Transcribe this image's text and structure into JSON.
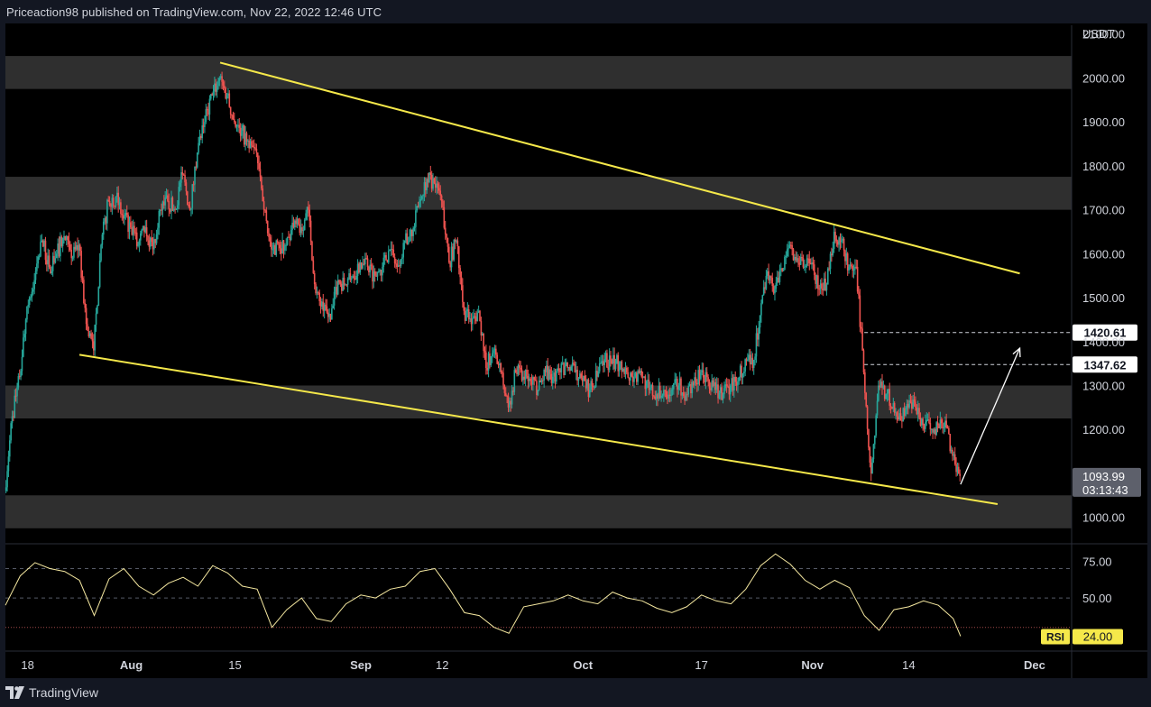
{
  "header": {
    "publisher": "Priceaction98 published on TradingView.com, Nov 22, 2022 12:46 UTC"
  },
  "footer": {
    "brand": "TradingView"
  },
  "colors": {
    "bull": "#26a69a",
    "bear": "#ef5350",
    "trendline": "#f5e84a",
    "zone": "#2f2f2f",
    "rsi": "#f5e8a0",
    "arrow": "#ffffff"
  },
  "chart_data": {
    "type": "candlestick",
    "currency_label": "USDT",
    "price_axis": {
      "ylim": [
        950,
        2120
      ],
      "ticks": [
        {
          "v": 2100,
          "label": "2100.00"
        },
        {
          "v": 2000,
          "label": "2000.00"
        },
        {
          "v": 1900,
          "label": "1900.00"
        },
        {
          "v": 1800,
          "label": "1800.00"
        },
        {
          "v": 1700,
          "label": "1700.00"
        },
        {
          "v": 1600,
          "label": "1600.00"
        },
        {
          "v": 1500,
          "label": "1500.00"
        },
        {
          "v": 1400,
          "label": "1400.00"
        },
        {
          "v": 1300,
          "label": "1300.00"
        },
        {
          "v": 1200,
          "label": "1200.00"
        },
        {
          "v": 1000,
          "label": "1000.00"
        }
      ]
    },
    "time_axis": {
      "xlim": [
        "2022-07-15",
        "2022-12-06"
      ],
      "ticks": [
        {
          "date": "2022-07-18",
          "label": "18",
          "bold": false
        },
        {
          "date": "2022-08-01",
          "label": "Aug",
          "bold": true
        },
        {
          "date": "2022-08-15",
          "label": "15",
          "bold": false
        },
        {
          "date": "2022-09-01",
          "label": "Sep",
          "bold": true
        },
        {
          "date": "2022-09-12",
          "label": "12",
          "bold": false
        },
        {
          "date": "2022-10-01",
          "label": "Oct",
          "bold": true
        },
        {
          "date": "2022-10-17",
          "label": "17",
          "bold": false
        },
        {
          "date": "2022-11-01",
          "label": "Nov",
          "bold": true
        },
        {
          "date": "2022-11-14",
          "label": "14",
          "bold": false
        },
        {
          "date": "2022-12-01",
          "label": "Dec",
          "bold": true
        }
      ]
    },
    "zones": [
      {
        "low": 1975,
        "high": 2050
      },
      {
        "low": 1700,
        "high": 1775
      },
      {
        "low": 1225,
        "high": 1300
      },
      {
        "low": 975,
        "high": 1050
      }
    ],
    "trendlines": [
      {
        "from": [
          "2022-08-13",
          2035
        ],
        "to": [
          "2022-11-29",
          1555
        ]
      },
      {
        "from": [
          "2022-07-25",
          1370
        ],
        "to": [
          "2022-11-26",
          1030
        ]
      }
    ],
    "hlines": [
      {
        "value": 1420.61,
        "from": "2022-11-08",
        "label": "1420.61"
      },
      {
        "value": 1347.62,
        "from": "2022-11-08",
        "label": "1347.62"
      }
    ],
    "projection_arrow": {
      "from": [
        "2022-11-21",
        1075
      ],
      "to": [
        "2022-11-29",
        1385
      ]
    },
    "last_price": {
      "value": 1093.99,
      "label": "1093.99",
      "countdown": "03:13:43"
    },
    "price_path": [
      [
        "2022-07-15",
        1060
      ],
      [
        "2022-07-16",
        1230
      ],
      [
        "2022-07-17",
        1320
      ],
      [
        "2022-07-18",
        1480
      ],
      [
        "2022-07-19",
        1540
      ],
      [
        "2022-07-20",
        1630
      ],
      [
        "2022-07-21",
        1570
      ],
      [
        "2022-07-22",
        1600
      ],
      [
        "2022-07-23",
        1640
      ],
      [
        "2022-07-24",
        1590
      ],
      [
        "2022-07-25",
        1620
      ],
      [
        "2022-07-26",
        1440
      ],
      [
        "2022-07-27",
        1380
      ],
      [
        "2022-07-28",
        1620
      ],
      [
        "2022-07-29",
        1720
      ],
      [
        "2022-07-30",
        1730
      ],
      [
        "2022-07-31",
        1680
      ],
      [
        "2022-08-01",
        1660
      ],
      [
        "2022-08-02",
        1620
      ],
      [
        "2022-08-03",
        1660
      ],
      [
        "2022-08-04",
        1610
      ],
      [
        "2022-08-05",
        1700
      ],
      [
        "2022-08-06",
        1720
      ],
      [
        "2022-08-07",
        1700
      ],
      [
        "2022-08-08",
        1780
      ],
      [
        "2022-08-09",
        1700
      ],
      [
        "2022-08-10",
        1830
      ],
      [
        "2022-08-11",
        1900
      ],
      [
        "2022-08-12",
        1960
      ],
      [
        "2022-08-13",
        2000
      ],
      [
        "2022-08-14",
        1960
      ],
      [
        "2022-08-15",
        1900
      ],
      [
        "2022-08-16",
        1880
      ],
      [
        "2022-08-17",
        1840
      ],
      [
        "2022-08-18",
        1830
      ],
      [
        "2022-08-19",
        1700
      ],
      [
        "2022-08-20",
        1610
      ],
      [
        "2022-08-21",
        1620
      ],
      [
        "2022-08-22",
        1620
      ],
      [
        "2022-08-23",
        1660
      ],
      [
        "2022-08-24",
        1660
      ],
      [
        "2022-08-25",
        1700
      ],
      [
        "2022-08-26",
        1510
      ],
      [
        "2022-08-27",
        1470
      ],
      [
        "2022-08-28",
        1450
      ],
      [
        "2022-08-29",
        1540
      ],
      [
        "2022-08-30",
        1530
      ],
      [
        "2022-08-31",
        1550
      ],
      [
        "2022-09-01",
        1580
      ],
      [
        "2022-09-02",
        1570
      ],
      [
        "2022-09-03",
        1550
      ],
      [
        "2022-09-04",
        1570
      ],
      [
        "2022-09-05",
        1610
      ],
      [
        "2022-09-06",
        1570
      ],
      [
        "2022-09-07",
        1630
      ],
      [
        "2022-09-08",
        1640
      ],
      [
        "2022-09-09",
        1720
      ],
      [
        "2022-09-10",
        1770
      ],
      [
        "2022-09-11",
        1760
      ],
      [
        "2022-09-12",
        1720
      ],
      [
        "2022-09-13",
        1580
      ],
      [
        "2022-09-14",
        1630
      ],
      [
        "2022-09-15",
        1470
      ],
      [
        "2022-09-16",
        1440
      ],
      [
        "2022-09-17",
        1470
      ],
      [
        "2022-09-18",
        1340
      ],
      [
        "2022-09-19",
        1380
      ],
      [
        "2022-09-20",
        1330
      ],
      [
        "2022-09-21",
        1250
      ],
      [
        "2022-09-22",
        1330
      ],
      [
        "2022-09-23",
        1320
      ],
      [
        "2022-09-24",
        1310
      ],
      [
        "2022-09-25",
        1290
      ],
      [
        "2022-09-26",
        1330
      ],
      [
        "2022-09-27",
        1320
      ],
      [
        "2022-09-28",
        1330
      ],
      [
        "2022-09-29",
        1340
      ],
      [
        "2022-09-30",
        1330
      ],
      [
        "2022-10-01",
        1310
      ],
      [
        "2022-10-02",
        1290
      ],
      [
        "2022-10-03",
        1320
      ],
      [
        "2022-10-04",
        1360
      ],
      [
        "2022-10-05",
        1350
      ],
      [
        "2022-10-06",
        1350
      ],
      [
        "2022-10-07",
        1330
      ],
      [
        "2022-10-08",
        1320
      ],
      [
        "2022-10-09",
        1320
      ],
      [
        "2022-10-10",
        1290
      ],
      [
        "2022-10-11",
        1280
      ],
      [
        "2022-10-12",
        1290
      ],
      [
        "2022-10-13",
        1290
      ],
      [
        "2022-10-14",
        1300
      ],
      [
        "2022-10-15",
        1280
      ],
      [
        "2022-10-16",
        1300
      ],
      [
        "2022-10-17",
        1330
      ],
      [
        "2022-10-18",
        1310
      ],
      [
        "2022-10-19",
        1290
      ],
      [
        "2022-10-20",
        1280
      ],
      [
        "2022-10-21",
        1300
      ],
      [
        "2022-10-22",
        1310
      ],
      [
        "2022-10-23",
        1360
      ],
      [
        "2022-10-24",
        1340
      ],
      [
        "2022-10-25",
        1460
      ],
      [
        "2022-10-26",
        1560
      ],
      [
        "2022-10-27",
        1520
      ],
      [
        "2022-10-28",
        1560
      ],
      [
        "2022-10-29",
        1620
      ],
      [
        "2022-10-30",
        1590
      ],
      [
        "2022-10-31",
        1570
      ],
      [
        "2022-11-01",
        1580
      ],
      [
        "2022-11-02",
        1520
      ],
      [
        "2022-11-03",
        1530
      ],
      [
        "2022-11-04",
        1650
      ],
      [
        "2022-11-05",
        1630
      ],
      [
        "2022-11-06",
        1570
      ],
      [
        "2022-11-07",
        1570
      ],
      [
        "2022-11-08",
        1330
      ],
      [
        "2022-11-09",
        1100
      ],
      [
        "2022-11-10",
        1300
      ],
      [
        "2022-11-11",
        1280
      ],
      [
        "2022-11-12",
        1260
      ],
      [
        "2022-11-13",
        1220
      ],
      [
        "2022-11-14",
        1250
      ],
      [
        "2022-11-15",
        1250
      ],
      [
        "2022-11-16",
        1210
      ],
      [
        "2022-11-17",
        1200
      ],
      [
        "2022-11-18",
        1210
      ],
      [
        "2022-11-19",
        1220
      ],
      [
        "2022-11-20",
        1140
      ],
      [
        "2022-11-21",
        1094
      ]
    ],
    "rsi": {
      "label": "RSI",
      "value_label": "24.00",
      "ylim": [
        20,
        85
      ],
      "levels": [
        {
          "v": 70,
          "style": "dashed"
        },
        {
          "v": 50,
          "style": "dashed"
        },
        {
          "v": 30,
          "style": "dotted"
        }
      ],
      "ticks": [
        {
          "v": 75,
          "label": "75.00"
        },
        {
          "v": 50,
          "label": "50.00"
        }
      ],
      "path": [
        [
          "2022-07-15",
          45
        ],
        [
          "2022-07-17",
          65
        ],
        [
          "2022-07-19",
          74
        ],
        [
          "2022-07-21",
          70
        ],
        [
          "2022-07-23",
          68
        ],
        [
          "2022-07-25",
          62
        ],
        [
          "2022-07-27",
          38
        ],
        [
          "2022-07-29",
          63
        ],
        [
          "2022-07-31",
          70
        ],
        [
          "2022-08-02",
          58
        ],
        [
          "2022-08-04",
          52
        ],
        [
          "2022-08-06",
          60
        ],
        [
          "2022-08-08",
          64
        ],
        [
          "2022-08-10",
          58
        ],
        [
          "2022-08-12",
          72
        ],
        [
          "2022-08-14",
          67
        ],
        [
          "2022-08-16",
          58
        ],
        [
          "2022-08-18",
          56
        ],
        [
          "2022-08-20",
          30
        ],
        [
          "2022-08-22",
          42
        ],
        [
          "2022-08-24",
          50
        ],
        [
          "2022-08-26",
          36
        ],
        [
          "2022-08-28",
          34
        ],
        [
          "2022-08-30",
          46
        ],
        [
          "2022-09-01",
          52
        ],
        [
          "2022-09-03",
          50
        ],
        [
          "2022-09-05",
          56
        ],
        [
          "2022-09-07",
          58
        ],
        [
          "2022-09-09",
          68
        ],
        [
          "2022-09-11",
          70
        ],
        [
          "2022-09-13",
          56
        ],
        [
          "2022-09-15",
          40
        ],
        [
          "2022-09-17",
          38
        ],
        [
          "2022-09-19",
          30
        ],
        [
          "2022-09-21",
          26
        ],
        [
          "2022-09-23",
          44
        ],
        [
          "2022-09-25",
          46
        ],
        [
          "2022-09-27",
          48
        ],
        [
          "2022-09-29",
          52
        ],
        [
          "2022-10-01",
          48
        ],
        [
          "2022-10-03",
          46
        ],
        [
          "2022-10-05",
          54
        ],
        [
          "2022-10-07",
          50
        ],
        [
          "2022-10-09",
          48
        ],
        [
          "2022-10-11",
          43
        ],
        [
          "2022-10-13",
          40
        ],
        [
          "2022-10-15",
          44
        ],
        [
          "2022-10-17",
          52
        ],
        [
          "2022-10-19",
          48
        ],
        [
          "2022-10-21",
          46
        ],
        [
          "2022-10-23",
          56
        ],
        [
          "2022-10-25",
          72
        ],
        [
          "2022-10-27",
          80
        ],
        [
          "2022-10-29",
          73
        ],
        [
          "2022-10-31",
          62
        ],
        [
          "2022-11-02",
          56
        ],
        [
          "2022-11-04",
          62
        ],
        [
          "2022-11-06",
          57
        ],
        [
          "2022-11-08",
          38
        ],
        [
          "2022-11-10",
          28
        ],
        [
          "2022-11-12",
          42
        ],
        [
          "2022-11-14",
          44
        ],
        [
          "2022-11-16",
          48
        ],
        [
          "2022-11-18",
          45
        ],
        [
          "2022-11-20",
          36
        ],
        [
          "2022-11-21",
          24
        ]
      ]
    }
  }
}
